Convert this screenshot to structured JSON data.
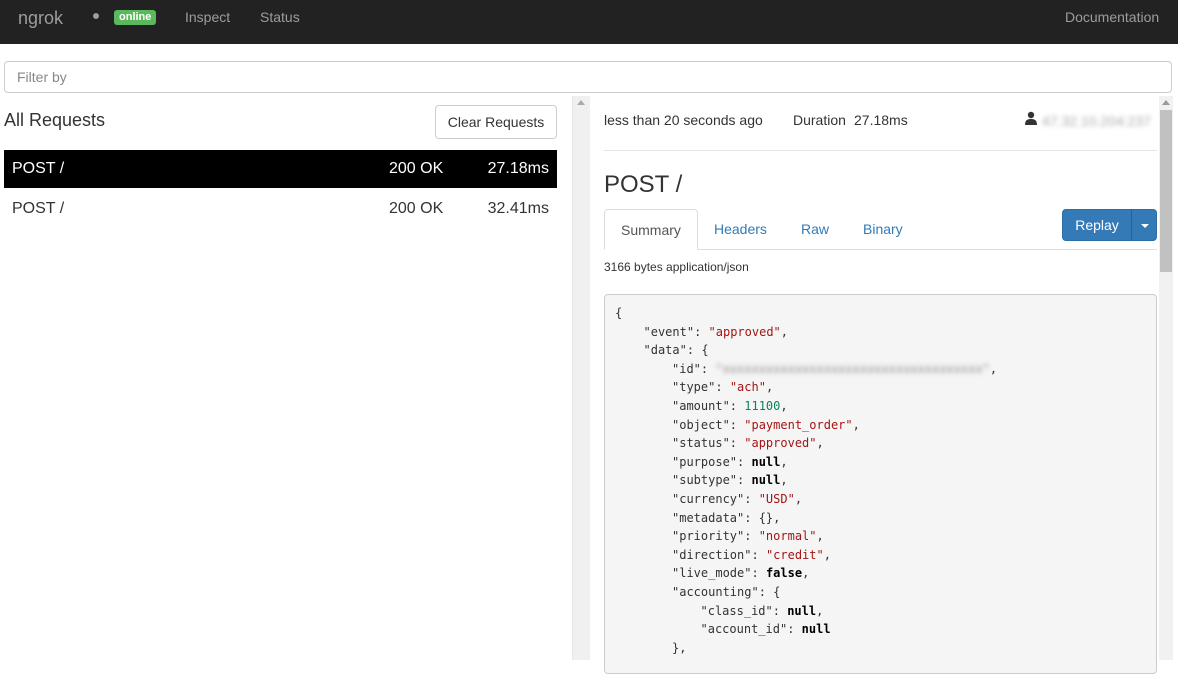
{
  "navbar": {
    "brand": "ngrok",
    "status_badge": "online",
    "links": [
      "Inspect",
      "Status"
    ],
    "documentation": "Documentation"
  },
  "filter": {
    "placeholder": "Filter by"
  },
  "requests": {
    "title": "All Requests",
    "clear_label": "Clear Requests",
    "items": [
      {
        "method_path": "POST /",
        "status": "200 OK",
        "duration": "27.18ms",
        "selected": true
      },
      {
        "method_path": "POST /",
        "status": "200 OK",
        "duration": "32.41ms",
        "selected": false
      }
    ]
  },
  "detail": {
    "time_ago": "less than 20 seconds ago",
    "duration_label": "Duration",
    "duration_value": "27.18ms",
    "client_ip": "47.32.10.204:237",
    "title": "POST /",
    "tabs": [
      "Summary",
      "Headers",
      "Raw",
      "Binary"
    ],
    "active_tab": "Summary",
    "replay_label": "Replay",
    "size_info": "3166 bytes application/json"
  },
  "json_lines": [
    {
      "indent": 0,
      "key": "",
      "sep": "",
      "value": "{",
      "vtype": "punct",
      "trail": ""
    },
    {
      "indent": 1,
      "key": "\"event\"",
      "sep": ": ",
      "value": "\"approved\"",
      "vtype": "str",
      "trail": ","
    },
    {
      "indent": 1,
      "key": "\"data\"",
      "sep": ": ",
      "value": "{",
      "vtype": "punct",
      "trail": ""
    },
    {
      "indent": 2,
      "key": "\"id\"",
      "sep": ": ",
      "value": "\"xxxxxxxxxxxxxxxxxxxxxxxxxxxxxxxxxxxx\"",
      "vtype": "blur",
      "trail": ","
    },
    {
      "indent": 2,
      "key": "\"type\"",
      "sep": ": ",
      "value": "\"ach\"",
      "vtype": "str",
      "trail": ","
    },
    {
      "indent": 2,
      "key": "\"amount\"",
      "sep": ": ",
      "value": "11100",
      "vtype": "num",
      "trail": ","
    },
    {
      "indent": 2,
      "key": "\"object\"",
      "sep": ": ",
      "value": "\"payment_order\"",
      "vtype": "str",
      "trail": ","
    },
    {
      "indent": 2,
      "key": "\"status\"",
      "sep": ": ",
      "value": "\"approved\"",
      "vtype": "str",
      "trail": ","
    },
    {
      "indent": 2,
      "key": "\"purpose\"",
      "sep": ": ",
      "value": "null",
      "vtype": "kw",
      "trail": ","
    },
    {
      "indent": 2,
      "key": "\"subtype\"",
      "sep": ": ",
      "value": "null",
      "vtype": "kw",
      "trail": ","
    },
    {
      "indent": 2,
      "key": "\"currency\"",
      "sep": ": ",
      "value": "\"USD\"",
      "vtype": "str",
      "trail": ","
    },
    {
      "indent": 2,
      "key": "\"metadata\"",
      "sep": ": ",
      "value": "{}",
      "vtype": "punct",
      "trail": ","
    },
    {
      "indent": 2,
      "key": "\"priority\"",
      "sep": ": ",
      "value": "\"normal\"",
      "vtype": "str",
      "trail": ","
    },
    {
      "indent": 2,
      "key": "\"direction\"",
      "sep": ": ",
      "value": "\"credit\"",
      "vtype": "str",
      "trail": ","
    },
    {
      "indent": 2,
      "key": "\"live_mode\"",
      "sep": ": ",
      "value": "false",
      "vtype": "kw",
      "trail": ","
    },
    {
      "indent": 2,
      "key": "\"accounting\"",
      "sep": ": ",
      "value": "{",
      "vtype": "punct",
      "trail": ""
    },
    {
      "indent": 3,
      "key": "\"class_id\"",
      "sep": ": ",
      "value": "null",
      "vtype": "kw",
      "trail": ","
    },
    {
      "indent": 3,
      "key": "\"account_id\"",
      "sep": ": ",
      "value": "null",
      "vtype": "kw",
      "trail": ""
    },
    {
      "indent": 2,
      "key": "",
      "sep": "",
      "value": "}",
      "vtype": "punct",
      "trail": ","
    }
  ],
  "colors": {
    "navbar_bg": "#222222",
    "online_badge": "#5cb85c",
    "link_blue": "#337ab7",
    "selected_row": "#000000",
    "json_string": "#a31515",
    "json_number": "#098658"
  }
}
